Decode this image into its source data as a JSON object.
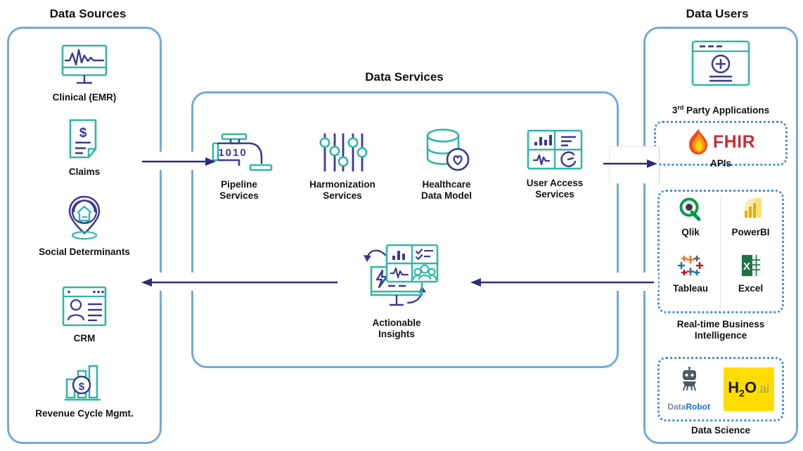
{
  "columns": {
    "left_title": "Data Sources",
    "center_title": "Data Services",
    "right_title": "Data Users"
  },
  "data_sources": [
    {
      "id": "clinical-emr",
      "label": "Clinical (EMR)",
      "icon": "monitor-ecg-icon"
    },
    {
      "id": "claims",
      "label": "Claims",
      "icon": "invoice-dollar-icon"
    },
    {
      "id": "social-determinants",
      "label": "Social Determinants",
      "icon": "home-location-pin-icon"
    },
    {
      "id": "crm",
      "label": "CRM",
      "icon": "user-profile-window-icon"
    },
    {
      "id": "revenue-cycle-mgmt",
      "label": "Revenue Cycle Mgmt.",
      "icon": "bar-chart-dollar-icon"
    }
  ],
  "data_services": [
    {
      "id": "pipeline-services",
      "label": "Pipeline\nServices",
      "icon": "faucet-binary-icon"
    },
    {
      "id": "harmonization-services",
      "label": "Harmonization\nServices",
      "icon": "sliders-icon"
    },
    {
      "id": "healthcare-data-model",
      "label": "Healthcare\nData Model",
      "icon": "database-heart-icon"
    },
    {
      "id": "user-access-services",
      "label": "User Access\nServices",
      "icon": "dashboard-grid-icon"
    }
  ],
  "actionable_insights": {
    "id": "actionable-insights",
    "label": "Actionable\nInsights",
    "icon": "insights-monitor-icon"
  },
  "data_users": {
    "third_party": {
      "label": "3rd Party Applications",
      "label_main": "3",
      "label_sup": "rd",
      "label_rest": " Party Applications",
      "icon": "browser-window-plus-icon"
    },
    "apis": {
      "label": "APIs",
      "logos": [
        {
          "id": "fhir",
          "name": "FHIR",
          "icon": "flame-icon",
          "text": "FHIR",
          "color": "#c4303a"
        }
      ]
    },
    "bi": {
      "label": "Real-time Business\nIntelligence",
      "logos": [
        {
          "id": "qlik",
          "name": "Qlik",
          "icon": "qlik-logo-icon",
          "color": "#009845"
        },
        {
          "id": "powerbi",
          "name": "PowerBI",
          "icon": "powerbi-logo-icon",
          "color": "#f2c811"
        },
        {
          "id": "tableau",
          "name": "Tableau",
          "icon": "tableau-logo-icon",
          "color": "#e8762d"
        },
        {
          "id": "excel",
          "name": "Excel",
          "icon": "excel-logo-icon",
          "color": "#217346"
        }
      ]
    },
    "data_science": {
      "label": "Data Science",
      "logos": [
        {
          "id": "datarobot",
          "name": "DataRobot",
          "text_a": "Data",
          "text_b": "Robot",
          "color_a": "#7a8b99",
          "color_b": "#1a6fd4",
          "icon": "datarobot-logo-icon"
        },
        {
          "id": "h2oai",
          "name": "H2O.ai",
          "text_a": "H",
          "text_sub": "2",
          "text_b": "O",
          "text_c": ".ai",
          "bg": "#ffdd00",
          "color": "#1a1a1a",
          "icon": "h2oai-logo-icon"
        }
      ]
    }
  },
  "arrows": [
    {
      "id": "sources-to-services",
      "direction": "right"
    },
    {
      "id": "services-to-users",
      "direction": "right"
    },
    {
      "id": "insights-to-sources",
      "direction": "left"
    },
    {
      "id": "users-to-insights",
      "direction": "left"
    }
  ],
  "theme": {
    "teal": "#31b6a8",
    "navy": "#3b3a8f",
    "panel_blue": "#74a9dd",
    "dotted_blue": "#4a90d9",
    "arrow_navy": "#2d2e7f"
  }
}
